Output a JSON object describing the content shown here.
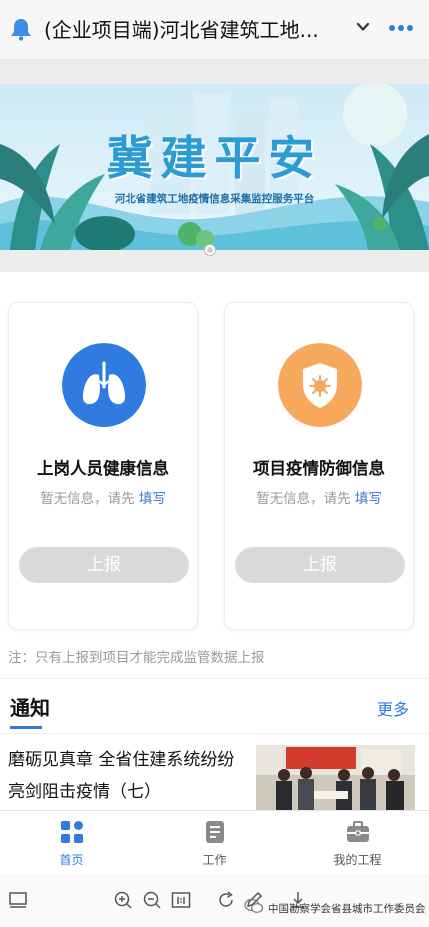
{
  "header": {
    "title": "(企业项目端)河北省建筑工地...",
    "icons": {
      "left": "bell-icon",
      "dropdown": "chevron-down-icon",
      "menu": "more-dots-icon"
    },
    "accent": "#2f7be0"
  },
  "banner": {
    "title": "冀建平安",
    "subtitle": "河北省建筑工地疫情信息采集监控服务平台"
  },
  "cards": [
    {
      "title": "上岗人员健康信息",
      "desc_prefix": "暂无信息，请先 ",
      "desc_link": "填写",
      "button": "上报",
      "icon": "lungs-icon",
      "color": "#2f7be0"
    },
    {
      "title": "项目疫情防御信息",
      "desc_prefix": "暂无信息，请先 ",
      "desc_link": "填写",
      "button": "上报",
      "icon": "virus-shield-icon",
      "color": "#f6a95a"
    }
  ],
  "note": "注：只有上报到项目才能完成监管数据上报",
  "notice": {
    "title": "通知",
    "more": "更多",
    "items": [
      {
        "line1": "磨砺见真章 全省住建系统纷纷",
        "line2": "亮剑阻击疫情（七）"
      }
    ]
  },
  "tabs": [
    {
      "label": "首页",
      "icon": "home-grid-icon",
      "active": true
    },
    {
      "label": "工作",
      "icon": "work-doc-icon",
      "active": false
    },
    {
      "label": "我的工程",
      "icon": "toolbox-icon",
      "active": false
    }
  ],
  "watermark": "中国勘察学会省县城市工作委员会"
}
